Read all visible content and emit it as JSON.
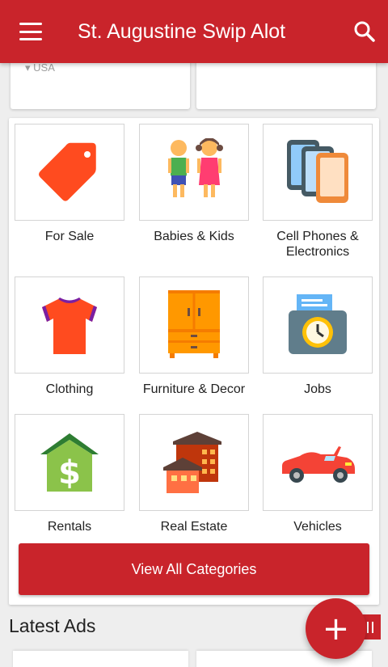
{
  "app": {
    "title": "St. Augustine Swip Alot"
  },
  "location": {
    "country": "USA"
  },
  "categories": [
    {
      "label": "For Sale",
      "icon": "tag-icon"
    },
    {
      "label": "Babies & Kids",
      "icon": "kids-icon"
    },
    {
      "label": "Cell Phones & Electronics",
      "icon": "devices-icon"
    },
    {
      "label": "Clothing",
      "icon": "shirt-icon"
    },
    {
      "label": "Furniture & Decor",
      "icon": "wardrobe-icon"
    },
    {
      "label": "Jobs",
      "icon": "time-clock-icon"
    },
    {
      "label": "Rentals",
      "icon": "house-dollar-icon"
    },
    {
      "label": "Real Estate",
      "icon": "buildings-icon"
    },
    {
      "label": "Vehicles",
      "icon": "car-icon"
    }
  ],
  "buttons": {
    "view_all": "View All Categories",
    "fab": "+"
  },
  "sections": {
    "latest_ads": "Latest Ads"
  },
  "colors": {
    "primary": "#c9242b",
    "background": "#eeeeee"
  }
}
